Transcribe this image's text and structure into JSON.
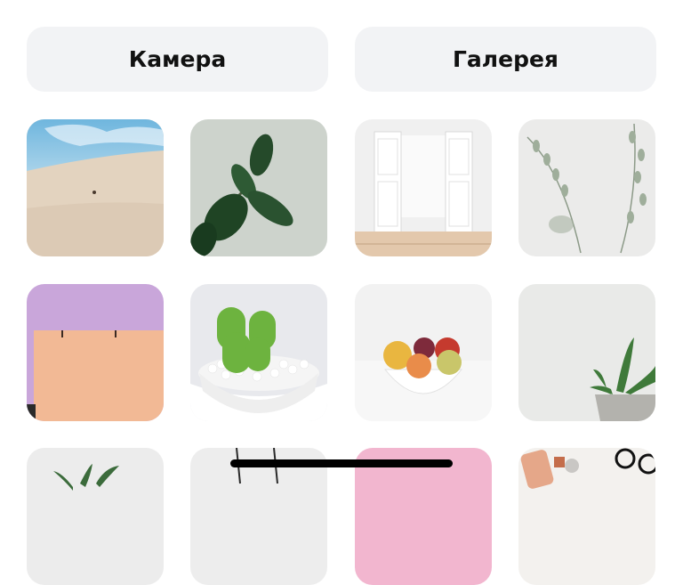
{
  "actions": {
    "camera_label": "Камера",
    "gallery_label": "Галерея"
  },
  "photos": [
    "desert-dune-photo",
    "rubber-plant-photo",
    "white-doors-room-photo",
    "eucalyptus-branches-photo",
    "peach-wall-lilac-sky-photo",
    "cactus-pot-photo",
    "fruit-bowl-photo",
    "succulent-pot-photo",
    "palm-leaf-photo",
    "hanging-wire-photo",
    "pink-backdrop-photo",
    "flatlay-accessories-photo"
  ],
  "colors": {
    "button_bg": "#f2f3f5",
    "text": "#111111",
    "home_indicator": "#000000"
  }
}
